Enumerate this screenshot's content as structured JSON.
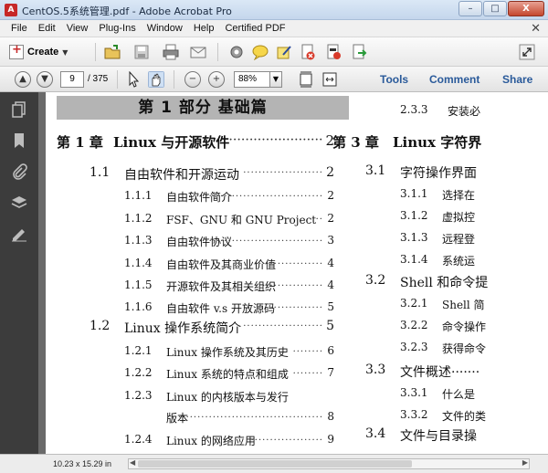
{
  "window": {
    "title": "CentOS.5系统管理.pdf - Adobe Acrobat Pro",
    "minimize": "–",
    "maximize": "□",
    "close": "X"
  },
  "menu": [
    "File",
    "Edit",
    "View",
    "Plug-Ins",
    "Window",
    "Help",
    "Certified PDF"
  ],
  "toolbar": {
    "create_label": "Create",
    "caret": "▼"
  },
  "nav": {
    "current_page": "9",
    "page_count": "/ 375",
    "zoom": "88%",
    "tabs": [
      "Tools",
      "Comment",
      "Share"
    ]
  },
  "document": {
    "part_banner": "第 1 部分    基础篇",
    "left_column": [
      {
        "num": "第 1 章",
        "title": "Linux 与开源软件",
        "dots": "·······················",
        "page": "2"
      },
      {
        "num": "1.1",
        "title": "自由软件和开源运动",
        "dots": "·····················",
        "page": "2"
      },
      {
        "num": "1.1.1",
        "title": "自由软件简介",
        "dots": "·······························",
        "page": "2"
      },
      {
        "num": "1.1.2",
        "title": "FSF、GNU 和 GNU Project",
        "dots": "···",
        "page": "2"
      },
      {
        "num": "1.1.3",
        "title": "自由软件协议",
        "dots": "·······························",
        "page": "3"
      },
      {
        "num": "1.1.4",
        "title": "自由软件及其商业价值",
        "dots": "·················",
        "page": "4"
      },
      {
        "num": "1.1.5",
        "title": "开源软件及其相关组织",
        "dots": "················",
        "page": "4"
      },
      {
        "num": "1.1.6",
        "title": "自由软件 v.s 开放源码",
        "dots": "··············",
        "page": "5"
      },
      {
        "num": "1.2",
        "title": "Linux 操作系统简介",
        "dots": "·····················",
        "page": "5"
      },
      {
        "num": "1.2.1",
        "title": "Linux 操作系统及其历史",
        "dots": "········",
        "page": "6"
      },
      {
        "num": "1.2.2",
        "title": "Linux 系统的特点和组成",
        "dots": "········",
        "page": "7"
      },
      {
        "num": "1.2.3",
        "title": "Linux 的内核版本与发行",
        "dots": "",
        "page": ""
      },
      {
        "num": "",
        "title": "版本",
        "dots": "·········································",
        "page": "8"
      },
      {
        "num": "1.2.4",
        "title": "Linux 的网络应用",
        "dots": "···················",
        "page": "9"
      }
    ],
    "right_column": [
      {
        "num": "2.3.3",
        "title": "安装必"
      },
      {
        "num": "第 3 章",
        "title": "Linux 字符界"
      },
      {
        "num": "3.1",
        "title": "字符操作界面"
      },
      {
        "num": "3.1.1",
        "title": "选择在"
      },
      {
        "num": "3.1.2",
        "title": "虚拟控"
      },
      {
        "num": "3.1.3",
        "title": "远程登"
      },
      {
        "num": "3.1.4",
        "title": "系统运"
      },
      {
        "num": "3.2",
        "title": "Shell 和命令提"
      },
      {
        "num": "3.2.1",
        "title": "Shell 简"
      },
      {
        "num": "3.2.2",
        "title": "命令操作"
      },
      {
        "num": "3.2.3",
        "title": "获得命令"
      },
      {
        "num": "3.3",
        "title": "文件概述·······"
      },
      {
        "num": "3.3.1",
        "title": "什么是"
      },
      {
        "num": "3.3.2",
        "title": "文件的类"
      },
      {
        "num": "3.4",
        "title": "文件与目录操"
      }
    ]
  },
  "status": {
    "page_size": "10.23 x 15.29 in"
  },
  "colors": {
    "nav_pane": "#3c3c3c",
    "doc_background": "#6a6a6a",
    "part_banner": "#b4b4b4",
    "accent_tab": "#2a5a9a"
  }
}
